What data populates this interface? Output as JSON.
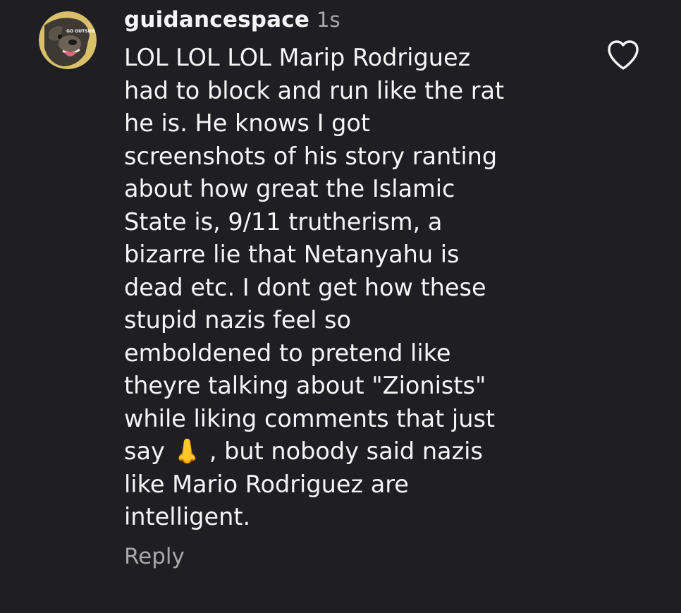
{
  "comment": {
    "username": "guidancespace",
    "timestamp": "1s",
    "text_lines": [
      "LOL LOL LOL Marip Rodriguez",
      "had to block and run like the rat",
      "he is. He knows I got",
      "screenshots of his story ranting",
      "about how great the Islamic",
      "State is, 9/11 trutherism, a",
      "bizarre lie that Netanyahu is",
      "dead etc. I dont get how these",
      "stupid nazis feel so",
      "emboldened to pretend like",
      "theyre talking about \"Zionists\"",
      "while liking comments that just",
      "say 👃 , but nobody said nazis",
      "like Mario Rodriguez are",
      "intelligent."
    ],
    "reply_label": "Reply",
    "avatar_icon": "dog-avatar-icon",
    "avatar_badge_text": "GO OUTSIDE",
    "like_icon": "heart-icon"
  },
  "colors": {
    "background": "#1f1f23",
    "text_primary": "#f5f5f5",
    "text_secondary": "#a8a8a8"
  }
}
